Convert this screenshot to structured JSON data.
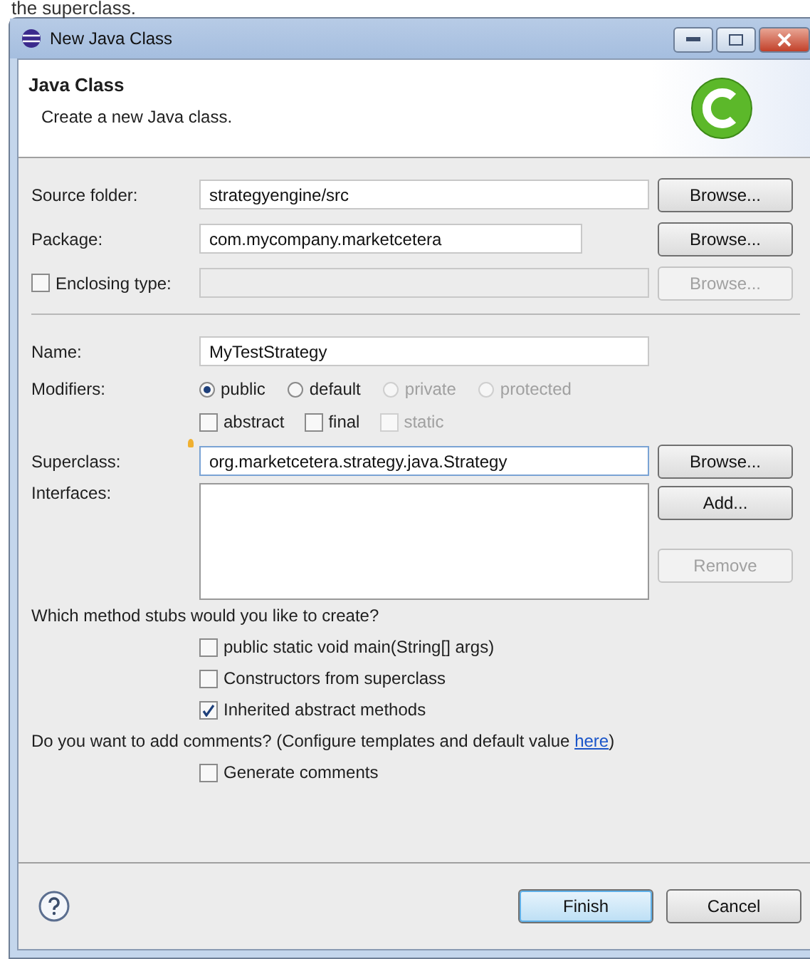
{
  "caption": "the superclass.",
  "window": {
    "title": "New Java Class"
  },
  "header": {
    "title": "Java Class",
    "description": "Create a new Java class."
  },
  "location_rows": [
    {
      "kind": "text",
      "label": "Source folder:",
      "value": "strategyengine/src",
      "disabled": false,
      "button": {
        "label": "Browse...",
        "disabled": false
      }
    },
    {
      "kind": "text",
      "label": "Package:",
      "value": "com.mycompany.marketcetera",
      "disabled": false,
      "button": {
        "label": "Browse...",
        "disabled": false
      }
    },
    {
      "kind": "check",
      "label": "Enclosing type:",
      "checked": false,
      "disabled": true,
      "button": {
        "label": "Browse...",
        "disabled": true
      }
    }
  ],
  "name": {
    "label": "Name:",
    "value": "MyTestStrategy"
  },
  "modifiers": {
    "label": "Modifiers:",
    "radios": [
      {
        "label": "public",
        "selected": true,
        "disabled": false
      },
      {
        "label": "default",
        "selected": false,
        "disabled": false
      },
      {
        "label": "private",
        "selected": false,
        "disabled": true
      },
      {
        "label": "protected",
        "selected": false,
        "disabled": true
      }
    ],
    "checks": [
      {
        "label": "abstract",
        "checked": false,
        "disabled": false
      },
      {
        "label": "final",
        "checked": false,
        "disabled": false
      },
      {
        "label": "static",
        "checked": false,
        "disabled": true
      }
    ]
  },
  "superclass": {
    "label": "Superclass:",
    "value": "org.marketcetera.strategy.java.Strategy",
    "button": {
      "label": "Browse...",
      "disabled": false
    }
  },
  "interfaces": {
    "label": "Interfaces:",
    "buttons": [
      {
        "label": "Add...",
        "disabled": false
      },
      {
        "label": "Remove",
        "disabled": true
      }
    ]
  },
  "stubs": {
    "question": "Which method stubs would you like to create?",
    "options": [
      {
        "label": "public static void main(String[] args)",
        "checked": false
      },
      {
        "label": "Constructors from superclass",
        "checked": false
      },
      {
        "label": "Inherited abstract methods",
        "checked": true
      }
    ]
  },
  "comments": {
    "question": "Do you want to add comments? (Configure templates and default value ",
    "link": "here",
    "question_end": ")",
    "options": [
      {
        "label": "Generate comments",
        "checked": false
      }
    ]
  },
  "footer": {
    "buttons": [
      {
        "label": "Finish",
        "default": true
      },
      {
        "label": "Cancel",
        "default": false
      }
    ]
  }
}
